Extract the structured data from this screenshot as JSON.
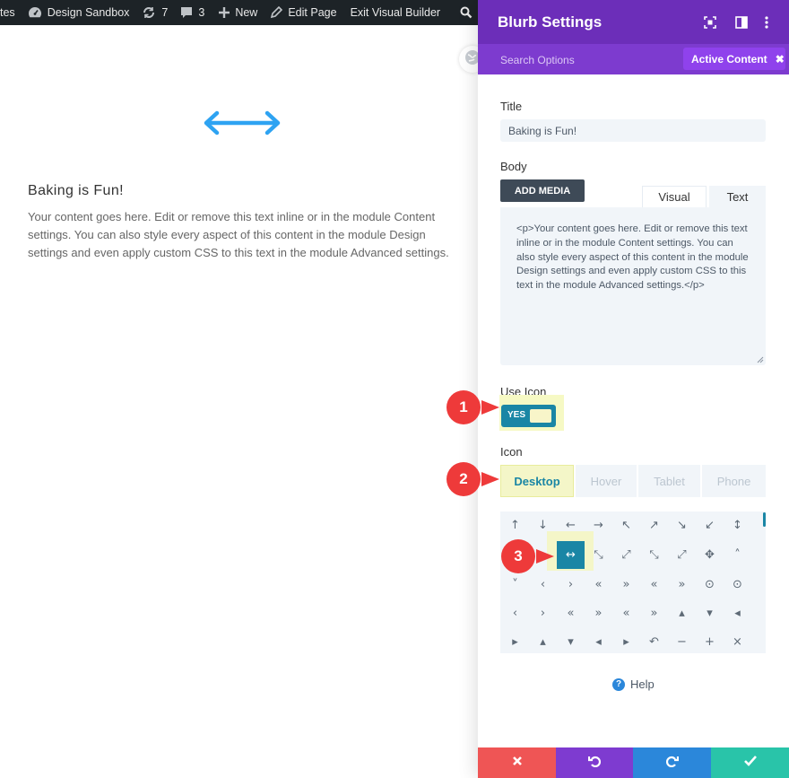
{
  "admin_bar": {
    "partial_item": "tes",
    "site_name": "Design Sandbox",
    "updates_count": "7",
    "comments_count": "3",
    "new_label": "New",
    "edit_page_label": "Edit Page",
    "exit_builder_label": "Exit Visual Builder",
    "partial_right": "I"
  },
  "canvas": {
    "blurb_title": "Baking is Fun!",
    "blurb_body": "Your content goes here. Edit or remove this text inline or in the module Content settings. You can also style every aspect of this content in the module Design settings and even apply custom CSS to this text in the module Advanced settings.",
    "icon_color": "#2ea3f2"
  },
  "panel": {
    "title": "Blurb Settings",
    "search_options": "Search Options",
    "active_filter": "Active Content",
    "header_color": "#6c2eb9",
    "title_label": "Title",
    "title_value": "Baking is Fun!",
    "body_label": "Body",
    "add_media_label": "ADD MEDIA",
    "tab_visual": "Visual",
    "tab_text": "Text",
    "body_value": "<p>Your content goes here. Edit or remove this text inline or in the module Content settings. You can also style every aspect of this content in the module Design settings and even apply custom CSS to this text in the module Advanced settings.</p>",
    "use_icon_label": "Use Icon",
    "use_icon_value": "YES",
    "icon_label": "Icon",
    "device_tabs": [
      "Desktop",
      "Hover",
      "Tablet",
      "Phone"
    ],
    "active_device": "Desktop",
    "icon_rows": [
      [
        "↑",
        "↓",
        "←",
        "→",
        "↖",
        "↗",
        "↘",
        "↙",
        "↕"
      ],
      [
        "↔",
        "⤡",
        "⤢",
        "⤡",
        "⤢",
        "✥",
        "˄"
      ],
      [
        "˅",
        "‹",
        "›",
        "«",
        "»",
        "«",
        "»",
        "⊙",
        "⊙"
      ],
      [
        "‹",
        "›",
        "«",
        "»",
        "«",
        "»",
        "▴",
        "▾",
        "◂"
      ],
      [
        "▸",
        "▴",
        "▾",
        "◂",
        "▸",
        "↶",
        "−",
        "+",
        "×"
      ]
    ],
    "selected_icon": "↔",
    "help_label": "Help",
    "footer_colors": [
      "#ef5555",
      "#7e3bd0",
      "#2b87da",
      "#29c4a9"
    ]
  },
  "callouts": [
    "1",
    "2",
    "3"
  ],
  "callout_color": "#ee3a3a"
}
